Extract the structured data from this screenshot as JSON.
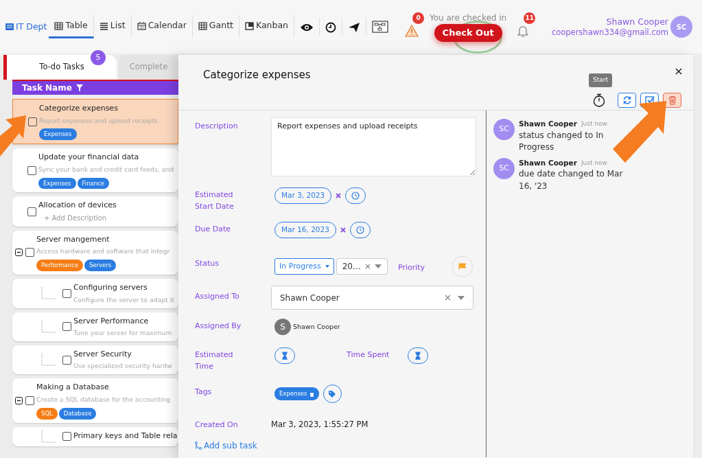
{
  "nav": {
    "brand": "IT Dept",
    "views": [
      {
        "label": "Table",
        "selected": true
      },
      {
        "label": "List",
        "selected": false
      },
      {
        "label": "Calendar",
        "selected": false
      },
      {
        "label": "Gantt",
        "selected": false
      },
      {
        "label": "Kanban",
        "selected": false
      }
    ],
    "alerts_count": "0",
    "checkin_text": "You are checked in",
    "checkout_label": "Check Out",
    "notifications_count": "11",
    "user": {
      "name": "Shawn Cooper",
      "email": "coopershawn334@gmail.com",
      "initials": "SC"
    }
  },
  "tasks_panel": {
    "tabs": [
      {
        "label": "To-do Tasks",
        "badge": "5",
        "selected": true
      },
      {
        "label": "Complete",
        "selected": false
      }
    ],
    "column_header": "Task Name",
    "tasks": [
      {
        "title": "Categorize expenses",
        "description": "Report expenses and upload receipts",
        "selected": true,
        "checked": false,
        "tags": [
          {
            "label": "Expenses",
            "color": "#2a7de1"
          }
        ]
      },
      {
        "title": "Update your financial data",
        "description": "Sync your bank and credit card feeds, and",
        "selected": false,
        "checked": false,
        "tags": [
          {
            "label": "Expenses",
            "color": "#2a7de1"
          },
          {
            "label": "Finance",
            "color": "#2a7de1"
          }
        ]
      },
      {
        "title": "Allocation of devices",
        "add_description": "+ Add Description",
        "selected": false,
        "checked": false
      },
      {
        "title": "Server mangement",
        "description": "Access hardware and software that integr",
        "selected": false,
        "checked": false,
        "expanded": true,
        "tags": [
          {
            "label": "Performance",
            "color": "#f57c14"
          },
          {
            "label": "Servers",
            "color": "#2a7de1"
          }
        ],
        "children": [
          {
            "title": "Configuring servers",
            "description": "Configure the server to adapt it",
            "selected": false,
            "checked": false
          },
          {
            "title": "Server Performance",
            "description": "Tune your server for maximum",
            "selected": false,
            "checked": false
          },
          {
            "title": "Server Security",
            "description": "Use specialized security hardw",
            "selected": false,
            "checked": false
          }
        ]
      },
      {
        "title": "Making a Database",
        "description": "Create a SQL database for the accounting",
        "selected": false,
        "checked": false,
        "expanded": true,
        "tags": [
          {
            "label": "SQL",
            "color": "#f57c14"
          },
          {
            "label": "Database",
            "color": "#2a7de1"
          }
        ],
        "children": [
          {
            "title": "Primary keys and Table rela",
            "selected": false,
            "checked": false
          }
        ]
      }
    ]
  },
  "detail": {
    "title": "Categorize expenses",
    "tooltip": "Start",
    "fields": [
      {
        "kind": "textarea",
        "label": "Description",
        "value": "Report expenses and upload receipts"
      },
      {
        "kind": "date",
        "label": "Estimated Start Date",
        "value": "Mar 3, 2023"
      },
      {
        "kind": "date",
        "label": "Due Date",
        "value": "Mar 16, 2023"
      },
      {
        "kind": "status",
        "label": "Status",
        "value": "In Progress",
        "secondary_value": "20…",
        "priority_label": "Priority"
      },
      {
        "kind": "select",
        "label": "Assigned To",
        "value": "Shawn Cooper"
      },
      {
        "kind": "person",
        "label": "Assigned By",
        "initial": "S",
        "value": "Shawn Cooper"
      },
      {
        "kind": "time",
        "label": "Estimated Time",
        "second_label": "Time Spent"
      },
      {
        "kind": "tags",
        "label": "Tags",
        "tags": [
          "Expenses"
        ]
      },
      {
        "kind": "text",
        "label": "Created On",
        "value": "Mar 3, 2023, 1:55:27 PM"
      }
    ],
    "add_subtask": "Add sub task",
    "activity": [
      {
        "initials": "SC",
        "name": "Shawn Cooper",
        "time": "Just now",
        "text": "status changed to In Progress"
      },
      {
        "initials": "SC",
        "name": "Shawn Cooper",
        "time": "Just now",
        "text": "due date changed to Mar 16, '23"
      }
    ]
  }
}
